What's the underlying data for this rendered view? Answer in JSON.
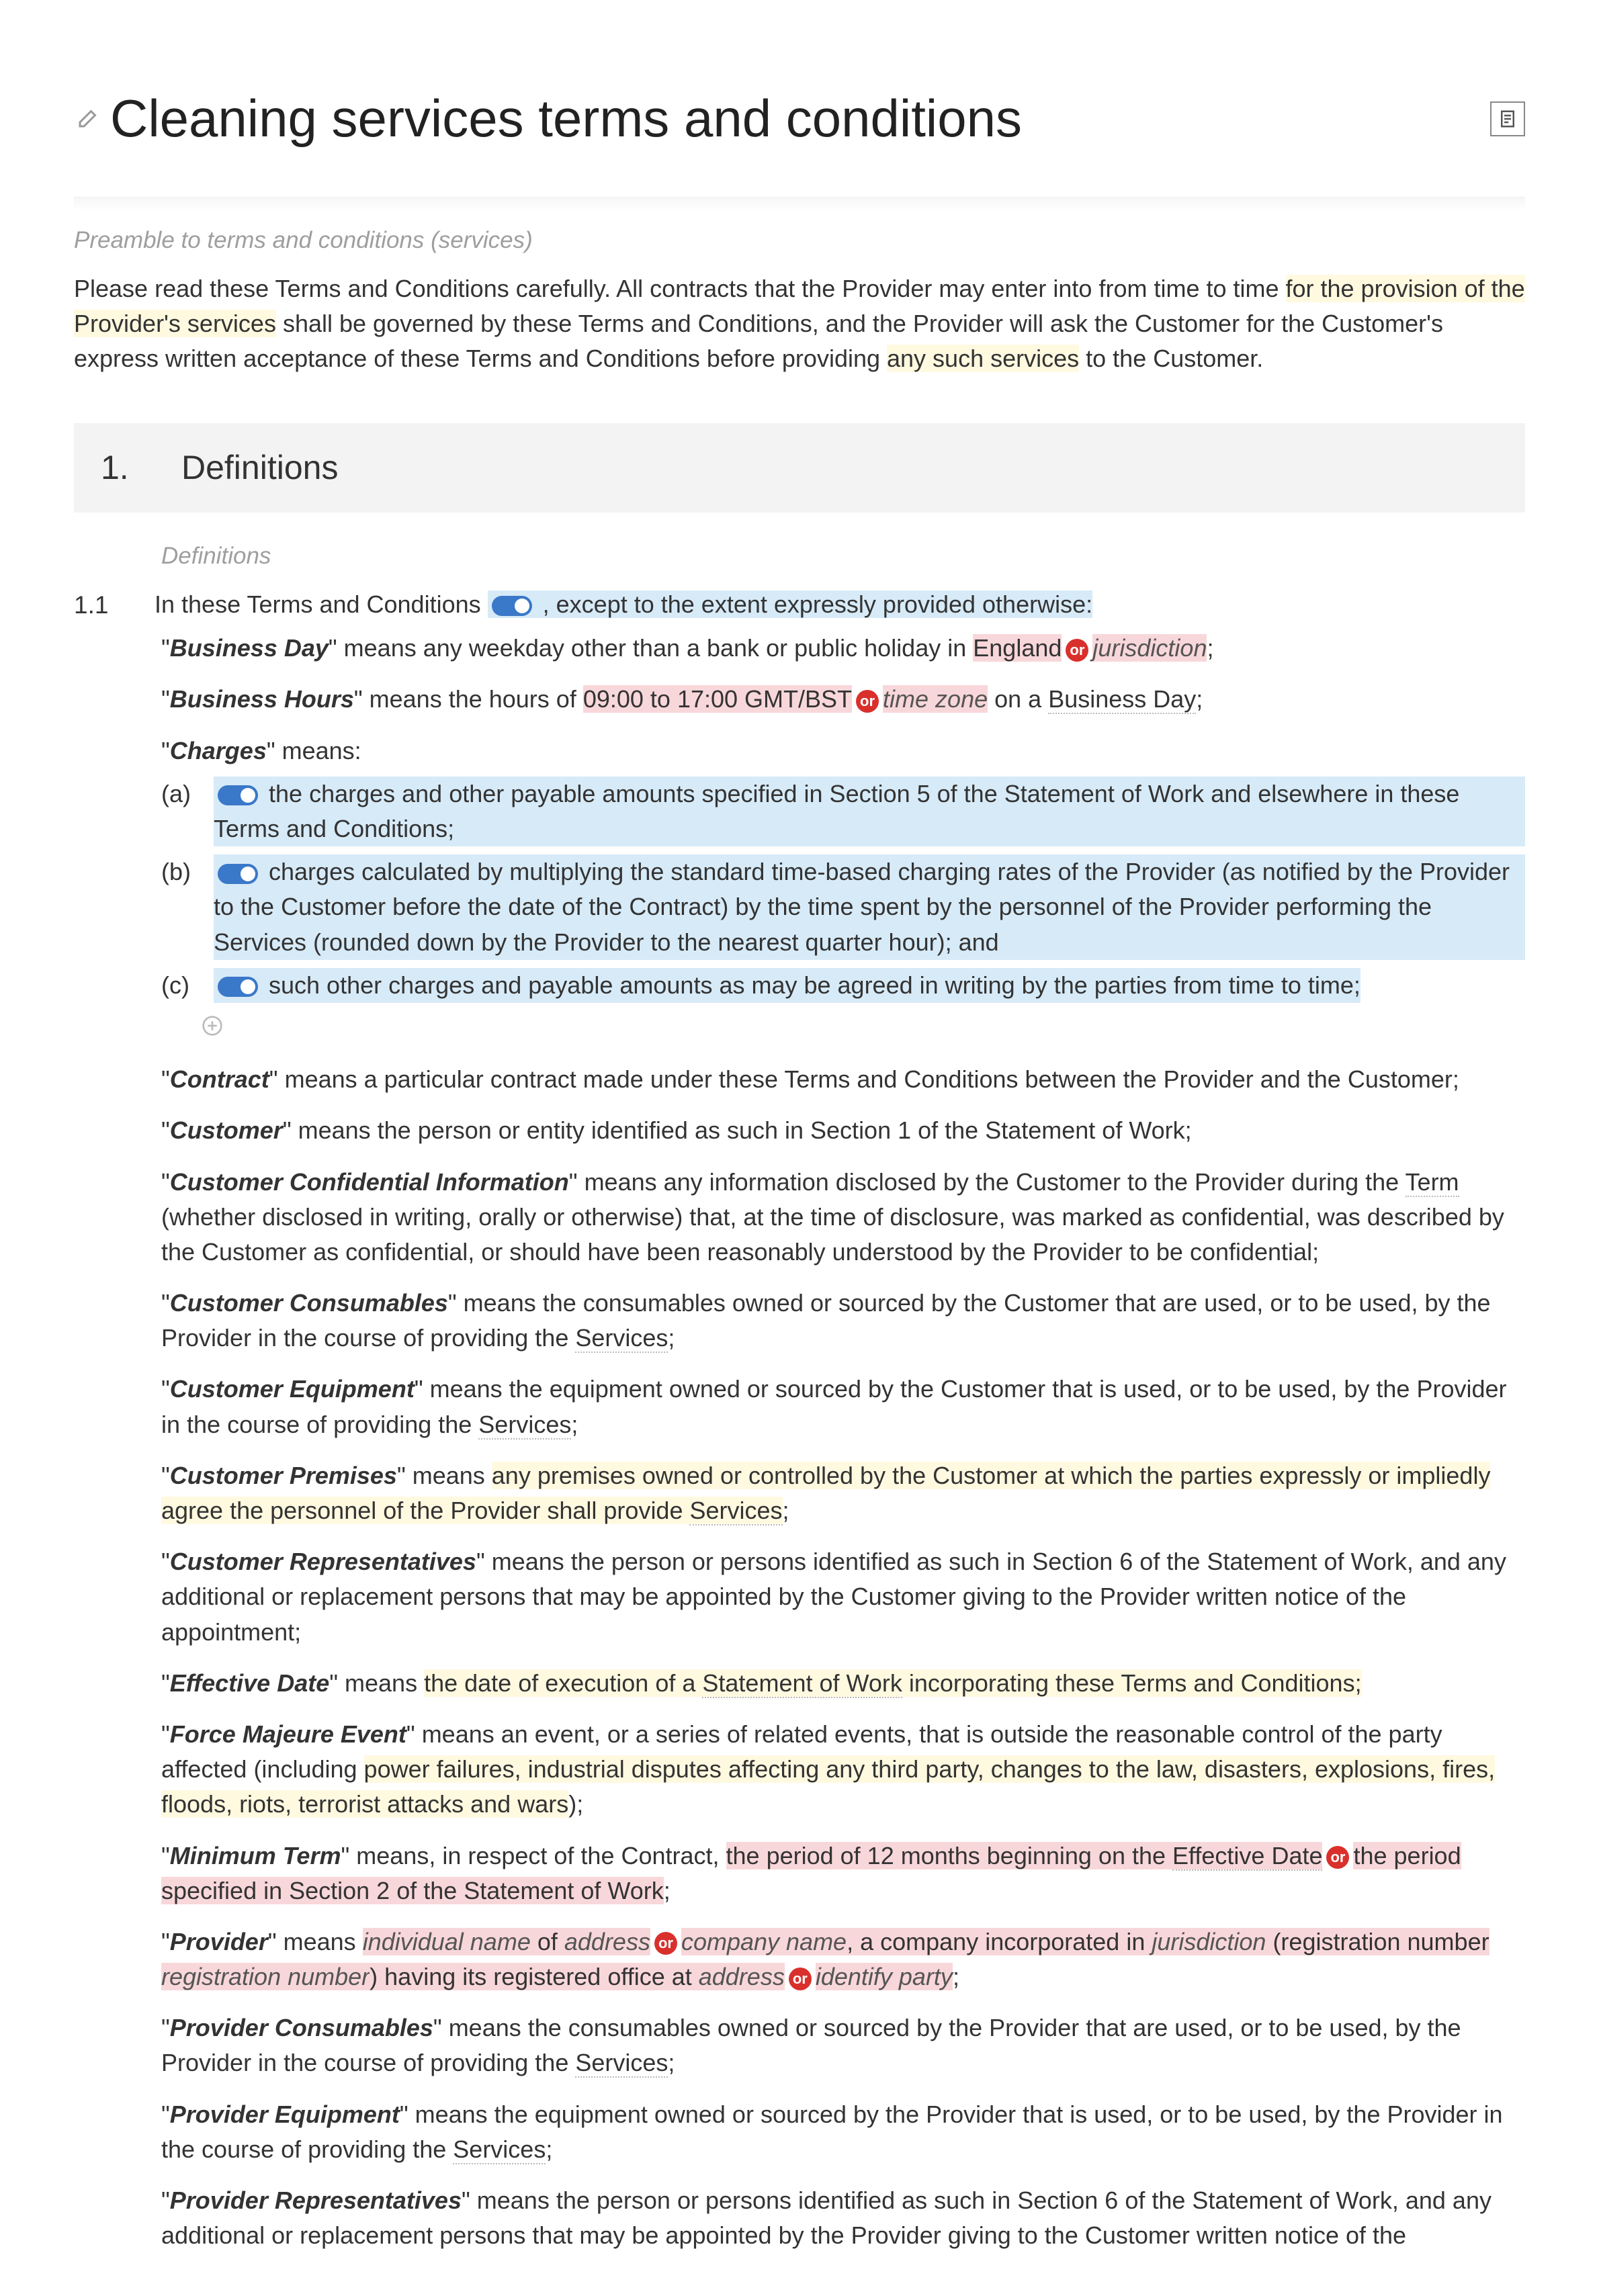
{
  "title": "Cleaning services terms and conditions",
  "preamble_label": "Preamble to terms and conditions (services)",
  "intro_a": "Please read these Terms and Conditions carefully. All contracts that the Provider may enter into from time to time ",
  "intro_b": "for the provision of the Provider's services",
  "intro_c": " shall be governed by these Terms and Conditions, and the Provider will ask the Customer for the Customer's express written acceptance of these Terms and Conditions before providing ",
  "intro_d": "any such services",
  "intro_e": " to the Customer.",
  "sec1_num": "1.",
  "sec1_title": "Definitions",
  "sec1_sublabel": "Definitions",
  "s11_num": "1.1",
  "s11_a": "In these Terms and Conditions",
  "s11_b": ", except to the extent expressly provided otherwise:",
  "bd_term": "Business Day",
  "bd_a": "\" means any weekday other than a bank or public holiday in ",
  "bd_b": "England",
  "bd_c": "jurisdiction",
  "bh_term": "Business Hours",
  "bh_a": "\" means the hours of ",
  "bh_b": "09:00 to 17:00 GMT/BST",
  "bh_c": "time zone",
  "bh_d": " on a ",
  "bh_e": "Business Day",
  "ch_term": "Charges",
  "ch_means": "\" means:",
  "ch_a_let": "(a)",
  "ch_a": "the charges and other payable amounts specified in Section 5 of the Statement of Work and elsewhere in these Terms and Conditions;",
  "ch_b_let": "(b)",
  "ch_b": "charges calculated by multiplying the standard time-based charging rates of the Provider (as notified by the Provider to the Customer before the date of the Contract) by the time spent by the personnel of the Provider performing the Services (rounded down by the Provider to the nearest quarter hour); and",
  "ch_c_let": "(c)",
  "ch_c": "such other charges and payable amounts as may be agreed in writing by the parties from time to time;",
  "contract_term": "Contract",
  "contract_def": "\" means a particular contract made under these Terms and Conditions between the Provider and the Customer;",
  "customer_term": "Customer",
  "customer_def": "\" means the person or entity identified as such in Section 1 of the Statement of Work;",
  "cci_term": "Customer Confidential Information",
  "cci_a": "\" means any information disclosed by the Customer to the Provider during the ",
  "cci_b": "Term",
  "cci_c": " (whether disclosed in writing, orally or otherwise) that, at the time of disclosure, was marked as confidential, was described by the Customer as confidential, or should have been reasonably understood by the Provider to be confidential;",
  "cc_term": "Customer Consumables",
  "cc_a": "\" means the consumables owned or sourced by the Customer that are used, or to be used, by the Provider in the course of providing the ",
  "cc_b": "Services",
  "ce_term": "Customer Equipment",
  "ce_a": "\" means the equipment owned or sourced by the Customer that is used, or to be used, by the Provider in the course of providing the ",
  "cp_term": "Customer Premises",
  "cp_a": "\" means ",
  "cp_b": "any premises owned or controlled by the Customer at which the parties expressly or impliedly agree the personnel of the Provider shall provide ",
  "cr_term": "Customer Representatives",
  "cr_def": "\" means the person or persons identified as such in Section 6 of the Statement of Work, and any additional or replacement persons that may be appointed by the Customer giving to the Provider written notice of the appointment;",
  "ed_term": "Effective Date",
  "ed_a": "\" means ",
  "ed_b": "the date of execution of a ",
  "ed_c": "Statement of Work",
  "ed_d": " incorporating these Terms and Conditions;",
  "fm_term": "Force Majeure Event",
  "fm_a": "\" means an event, or a series of related events, that is outside the reasonable control of the party affected (including ",
  "fm_b": "power failures, industrial disputes affecting any third party, changes to the law, disasters, explosions, fires, floods, riots, terrorist attacks and wars",
  "fm_c": ");",
  "mt_term": "Minimum Term",
  "mt_a": "\" means, in respect of the Contract, ",
  "mt_b": "the period of 12 months beginning on the ",
  "mt_c": "Effective Date",
  "mt_d": "the period specified in Section 2 of the Statement of Work",
  "pr_term": "Provider",
  "pr_a": "\" means ",
  "pr_b": "individual name",
  "pr_c": " of ",
  "pr_d": "address",
  "pr_e": "company name",
  "pr_f": ", a company incorporated in ",
  "pr_g": "jurisdiction",
  "pr_h": " (registration number ",
  "pr_i": "registration number",
  "pr_j": ") having its registered office at ",
  "pr_k": "address",
  "pr_l": "identify party",
  "pc_term": "Provider Consumables",
  "pc_a": "\" means the consumables owned or sourced by the Provider that are used, or to be used, by the Provider in the course of providing the ",
  "pe_term": "Provider Equipment",
  "pe_a": "\" means the equipment owned or sourced by the Provider that is used, or to be used, by the Provider in the course of providing the ",
  "prr_term": "Provider Representatives",
  "prr_def": "\" means the person or persons identified as such in Section 6 of the Statement of Work, and any additional or replacement persons that may be appointed by the Provider giving to the Customer written notice of the",
  "or_label": "or",
  "semicolon": ";",
  "quote": "\""
}
